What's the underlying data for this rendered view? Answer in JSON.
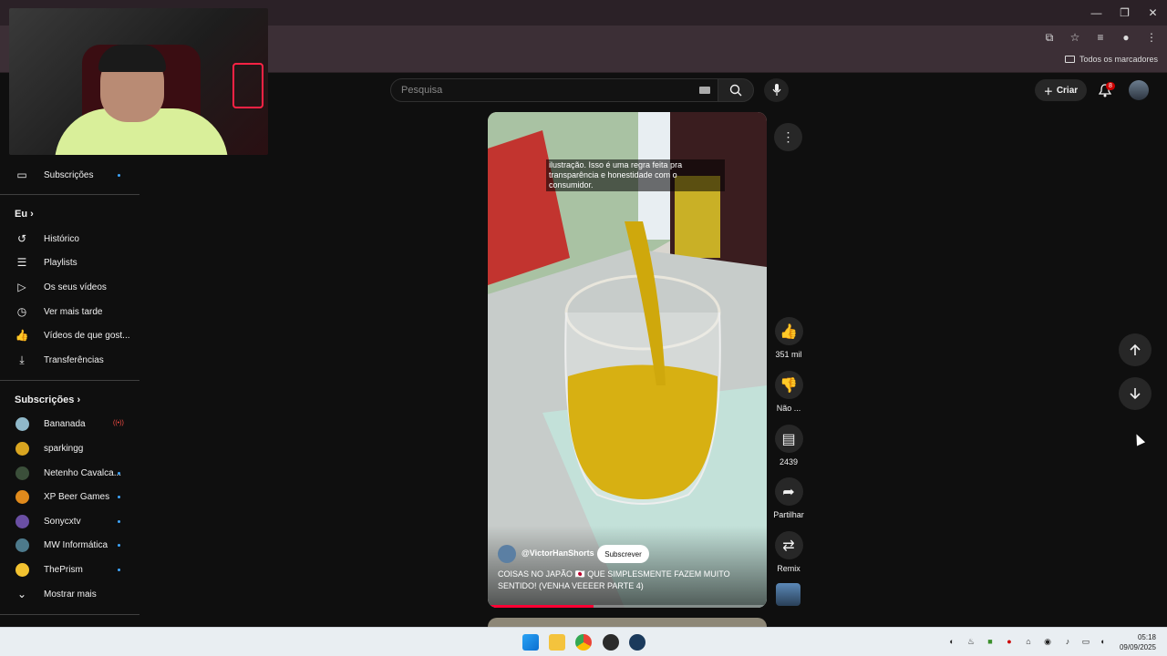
{
  "browser": {
    "bookmarks_all": "Todos os marcadores"
  },
  "sidebar": {
    "items_top": [
      {
        "label": "Subscrições",
        "icon": "subscriptions-icon",
        "dot": true
      }
    ],
    "you_section": {
      "title": "Eu",
      "items": [
        {
          "label": "Histórico",
          "icon": "history-icon"
        },
        {
          "label": "Playlists",
          "icon": "playlists-icon"
        },
        {
          "label": "Os seus vídeos",
          "icon": "your-videos-icon"
        },
        {
          "label": "Ver mais tarde",
          "icon": "watch-later-icon"
        },
        {
          "label": "Vídeos de que gost...",
          "icon": "liked-videos-icon"
        },
        {
          "label": "Transferências",
          "icon": "downloads-icon"
        }
      ]
    },
    "subscriptions_section": {
      "title": "Subscrições",
      "channels": [
        {
          "name": "Bananada",
          "status": "live",
          "color": "#8fb8c9"
        },
        {
          "name": "sparkingg",
          "status": "none",
          "color": "#d9a520"
        },
        {
          "name": "Netenho Cavalca...",
          "status": "dot",
          "color": "#3b4f3a"
        },
        {
          "name": "XP Beer Games",
          "status": "dot",
          "color": "#e08a1c"
        },
        {
          "name": "Sonycxtv",
          "status": "dot",
          "color": "#6a4fa3"
        },
        {
          "name": "MW Informática",
          "status": "dot",
          "color": "#4d7a8c"
        },
        {
          "name": "ThePrism",
          "status": "dot",
          "color": "#f2c230"
        }
      ],
      "show_more": "Mostrar mais"
    }
  },
  "header": {
    "search_placeholder": "Pesquisa",
    "create_label": "Criar",
    "notifications_count": "8"
  },
  "short": {
    "caption_text": "ilustração. Isso é uma regra feita pra transparência e honestidade com o consumidor.",
    "channel_handle": "@VictorHanShorts",
    "subscribe_label": "Subscrever",
    "title": "COISAS NO JAPÃO 🇯🇵 QUE SIMPLESMENTE FAZEM MUITO SENTIDO! (VENHA VEEEER PARTE 4)",
    "progress": 0.38
  },
  "actions": {
    "like_count": "351 mil",
    "dislike_label": "Não ...",
    "comments_count": "2439",
    "share_label": "Partilhar",
    "remix_label": "Remix"
  },
  "taskbar": {
    "time": "05:18",
    "date": "09/09/2025"
  },
  "colors": {
    "accent_red": "#ff0033",
    "subscription_dot": "#3ea6ff",
    "background": "#0f0f0f"
  }
}
